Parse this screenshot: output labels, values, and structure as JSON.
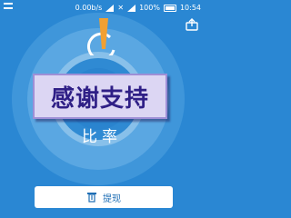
{
  "status_bar": {
    "net_speed": "0.00b/s",
    "carrier_glyph": "✕",
    "battery_percent": "100%",
    "time": "10:54"
  },
  "overlay": {
    "banner_text": "感谢支持"
  },
  "main": {
    "ratio_label": "比率"
  },
  "footer": {
    "withdraw_label": "提现"
  },
  "colors": {
    "background": "#2a87d3",
    "accent_orange": "#f0a032",
    "banner_bg": "#dcd6f3",
    "banner_text": "#2f1f86"
  },
  "icons": [
    "menu-icon",
    "signal-icon",
    "wifi-icon",
    "battery-icon",
    "share-icon",
    "withdraw-icon"
  ]
}
